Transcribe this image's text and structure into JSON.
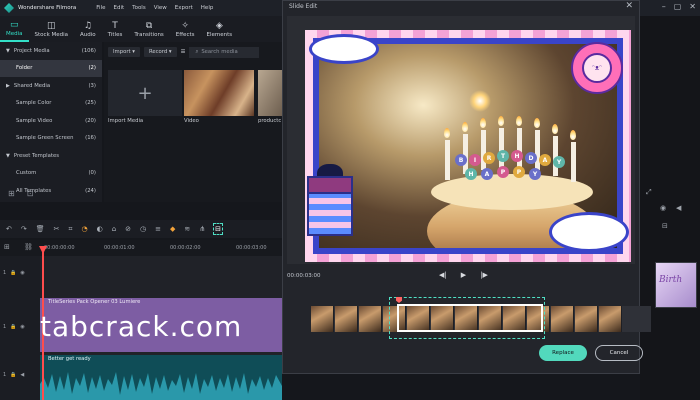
{
  "app": {
    "name": "Wondershare Filmora",
    "menu": [
      "File",
      "Edit",
      "Tools",
      "View",
      "Export",
      "Help"
    ]
  },
  "modules": [
    {
      "label": "Media",
      "icon": "folder-icon"
    },
    {
      "label": "Stock Media",
      "icon": "stock-icon"
    },
    {
      "label": "Audio",
      "icon": "music-icon"
    },
    {
      "label": "Titles",
      "icon": "text-icon"
    },
    {
      "label": "Transitions",
      "icon": "transition-icon"
    },
    {
      "label": "Effects",
      "icon": "effects-icon"
    },
    {
      "label": "Elements",
      "icon": "elements-icon"
    }
  ],
  "sidebar": {
    "items": [
      {
        "label": "Project Media",
        "count": "(106)"
      },
      {
        "label": "Folder",
        "count": "(2)"
      },
      {
        "label": "Shared Media",
        "count": "(3)"
      },
      {
        "label": "Sample Color",
        "count": "(25)"
      },
      {
        "label": "Sample Video",
        "count": "(20)"
      },
      {
        "label": "Sample Green Screen",
        "count": "(16)"
      },
      {
        "label": "Preset Templates",
        "count": ""
      },
      {
        "label": "Custom",
        "count": "(0)"
      },
      {
        "label": "All Templates",
        "count": "(24)"
      }
    ]
  },
  "media": {
    "import_label": "Import",
    "record_label": "Record",
    "search_placeholder": "Search media",
    "import_tile_label": "Import Media",
    "video_tile_label": "Video",
    "third_tile_label": "productc"
  },
  "ruler": {
    "marks": [
      "00:00:00:00",
      "00:00:01:00",
      "00:00:02:00",
      "00:00:03:00"
    ]
  },
  "timeline": {
    "video_clip_label": "TitleSeries Pack Opener 03 Lumiere",
    "audio_clip_label": "Better get ready",
    "track_labels": [
      "1",
      "1",
      "1"
    ]
  },
  "watermark": "tabcrack.com",
  "dialog": {
    "title": "Slide Edit",
    "close": "✕",
    "timecode": "00:00:03:00",
    "candle_balls": [
      "B",
      "I",
      "R",
      "T",
      "H",
      "D",
      "A",
      "Y",
      "H",
      "A",
      "P",
      "P",
      "Y"
    ],
    "replace_label": "Replace",
    "cancel_label": "Cancel"
  },
  "right_panel": {
    "thumb_text": "Birth"
  },
  "colors": {
    "accent": "#33e0c8",
    "playhead": "#ff4d4d",
    "video_clip": "#7d5da3",
    "audio_clip": "#0f4d57"
  }
}
